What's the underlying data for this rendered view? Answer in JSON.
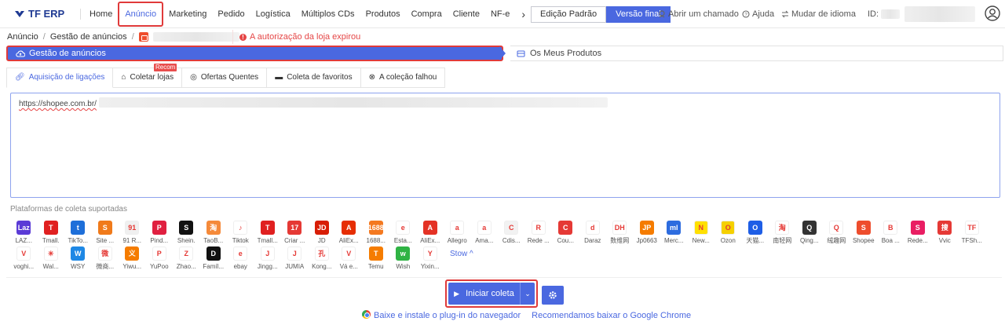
{
  "app": {
    "logo_text": "TF ERP"
  },
  "nav": {
    "items": [
      "Home",
      "Anúncio",
      "Marketing",
      "Pedido",
      "Logística",
      "Múltiplos CDs",
      "Produtos",
      "Compra",
      "Cliente",
      "NF-e"
    ],
    "more": "›"
  },
  "edition": {
    "standard": "Edição Padrão",
    "final": "Versão final"
  },
  "tools": {
    "ticket": "Abrir um chamado",
    "help": "Ajuda",
    "language": "Mudar de idioma",
    "id_label": "ID:"
  },
  "breadcrumb": {
    "root": "Anúncio",
    "page": "Gestão de anúncios"
  },
  "alert": {
    "text": "A autorização da loja expirou"
  },
  "tabs": {
    "active": "Gestão de anúncios",
    "other": "Os Meus Produtos"
  },
  "subtabs": [
    "Aquisição de ligações",
    "Coletar lojas",
    "Ofertas Quentes",
    "Coleta de favoritos",
    "A coleção falhou"
  ],
  "recom_badge": "Recom",
  "textarea": {
    "value": "https://shopee.com.br/"
  },
  "platforms": {
    "title": "Plataformas de coleta suportadas",
    "row1": [
      {
        "name": "LAZ...",
        "label": "Laz",
        "color": "#5b3bd6"
      },
      {
        "name": "Tmall.",
        "label": "T",
        "color": "#e02020"
      },
      {
        "name": "TikTo...",
        "label": "t",
        "color": "#1e6fd9"
      },
      {
        "name": "Site ...",
        "label": "S",
        "color": "#f07a1a"
      },
      {
        "name": "91 R...",
        "label": "91",
        "color": "#f0f0f0"
      },
      {
        "name": "Pind...",
        "label": "P",
        "color": "#e02040"
      },
      {
        "name": "Shein.",
        "label": "S",
        "color": "#111111"
      },
      {
        "name": "TaoB...",
        "label": "淘",
        "color": "#f58a3a"
      },
      {
        "name": "Tiktok",
        "label": "♪",
        "color": "#ffffff"
      },
      {
        "name": "Tmall...",
        "label": "T",
        "color": "#e02020"
      },
      {
        "name": "Criar ...",
        "label": "17",
        "color": "#e53935"
      },
      {
        "name": "JD",
        "label": "JD",
        "color": "#d81e06"
      },
      {
        "name": "AliEx...",
        "label": "A",
        "color": "#e62e04"
      },
      {
        "name": "1688...",
        "label": "1688",
        "color": "#f47920"
      },
      {
        "name": "Esta...",
        "label": "e",
        "color": "#ffffff"
      },
      {
        "name": "AliEx...",
        "label": "A",
        "color": "#e43225"
      },
      {
        "name": "Allegro",
        "label": "a",
        "color": "#ffffff"
      },
      {
        "name": "Ama...",
        "label": "a",
        "color": "#ffffff"
      },
      {
        "name": "Cdis...",
        "label": "C",
        "color": "#f2f2f2"
      },
      {
        "name": "Rede ...",
        "label": "R",
        "color": "#ffffff"
      },
      {
        "name": "Cou...",
        "label": "C",
        "color": "#e53935"
      },
      {
        "name": "Daraz",
        "label": "d",
        "color": "#ffffff"
      },
      {
        "name": "数维网",
        "label": "DH",
        "color": "#ffffff"
      },
      {
        "name": "Jp0663",
        "label": "JP",
        "color": "#f57c00"
      },
      {
        "name": "Merc...",
        "label": "ml",
        "color": "#2d6cdf"
      },
      {
        "name": "New...",
        "label": "N",
        "color": "#ffe000"
      },
      {
        "name": "Ozon",
        "label": "O",
        "color": "#f5d000"
      },
      {
        "name": "天猫...",
        "label": "O",
        "color": "#1e5ee6"
      },
      {
        "name": "南轻网",
        "label": "淘",
        "color": "#ffffff"
      },
      {
        "name": "Qing...",
        "label": "Q",
        "color": "#333333"
      },
      {
        "name": "绒趣网",
        "label": "Q",
        "color": "#ffffff"
      },
      {
        "name": "Shopee",
        "label": "S",
        "color": "#ee4d2d"
      },
      {
        "name": "Boa ...",
        "label": "B",
        "color": "#ffffff"
      },
      {
        "name": "Rede...",
        "label": "S",
        "color": "#e91e63"
      },
      {
        "name": "Vvic",
        "label": "搜",
        "color": "#e53935"
      },
      {
        "name": "TFSh...",
        "label": "TF",
        "color": "#ffffff"
      }
    ],
    "row2": [
      {
        "name": "voghi...",
        "label": "V",
        "color": "#ffffff"
      },
      {
        "name": "Wal...",
        "label": "✳",
        "color": "#ffffff"
      },
      {
        "name": "WSY",
        "label": "W",
        "color": "#1e88e5"
      },
      {
        "name": "微商...",
        "label": "微",
        "color": "#ffffff"
      },
      {
        "name": "Yiwu...",
        "label": "义",
        "color": "#f57c00"
      },
      {
        "name": "YuPoo",
        "label": "P",
        "color": "#ffffff"
      },
      {
        "name": "Zhao...",
        "label": "Z",
        "color": "#ffffff"
      },
      {
        "name": "Famíl...",
        "label": "D",
        "color": "#111111"
      },
      {
        "name": "ebay",
        "label": "e",
        "color": "#ffffff"
      },
      {
        "name": "Jingg...",
        "label": "J",
        "color": "#ffffff"
      },
      {
        "name": "JUMIA",
        "label": "J",
        "color": "#ffffff"
      },
      {
        "name": "Kong...",
        "label": "孔",
        "color": "#ffffff"
      },
      {
        "name": "Vá e...",
        "label": "V",
        "color": "#ffffff"
      },
      {
        "name": "Temu",
        "label": "T",
        "color": "#f57c00"
      },
      {
        "name": "Wish",
        "label": "w",
        "color": "#2fb344"
      },
      {
        "name": "Yixin...",
        "label": "Y",
        "color": "#ffffff"
      }
    ],
    "stow": "Stow ^"
  },
  "actions": {
    "start": "Iniciar coleta",
    "dropdown": "⌄"
  },
  "footer": {
    "install": "Baixe e instale o plug-in do navegador",
    "recommend": "Recomendamos baixar o Google Chrome"
  }
}
